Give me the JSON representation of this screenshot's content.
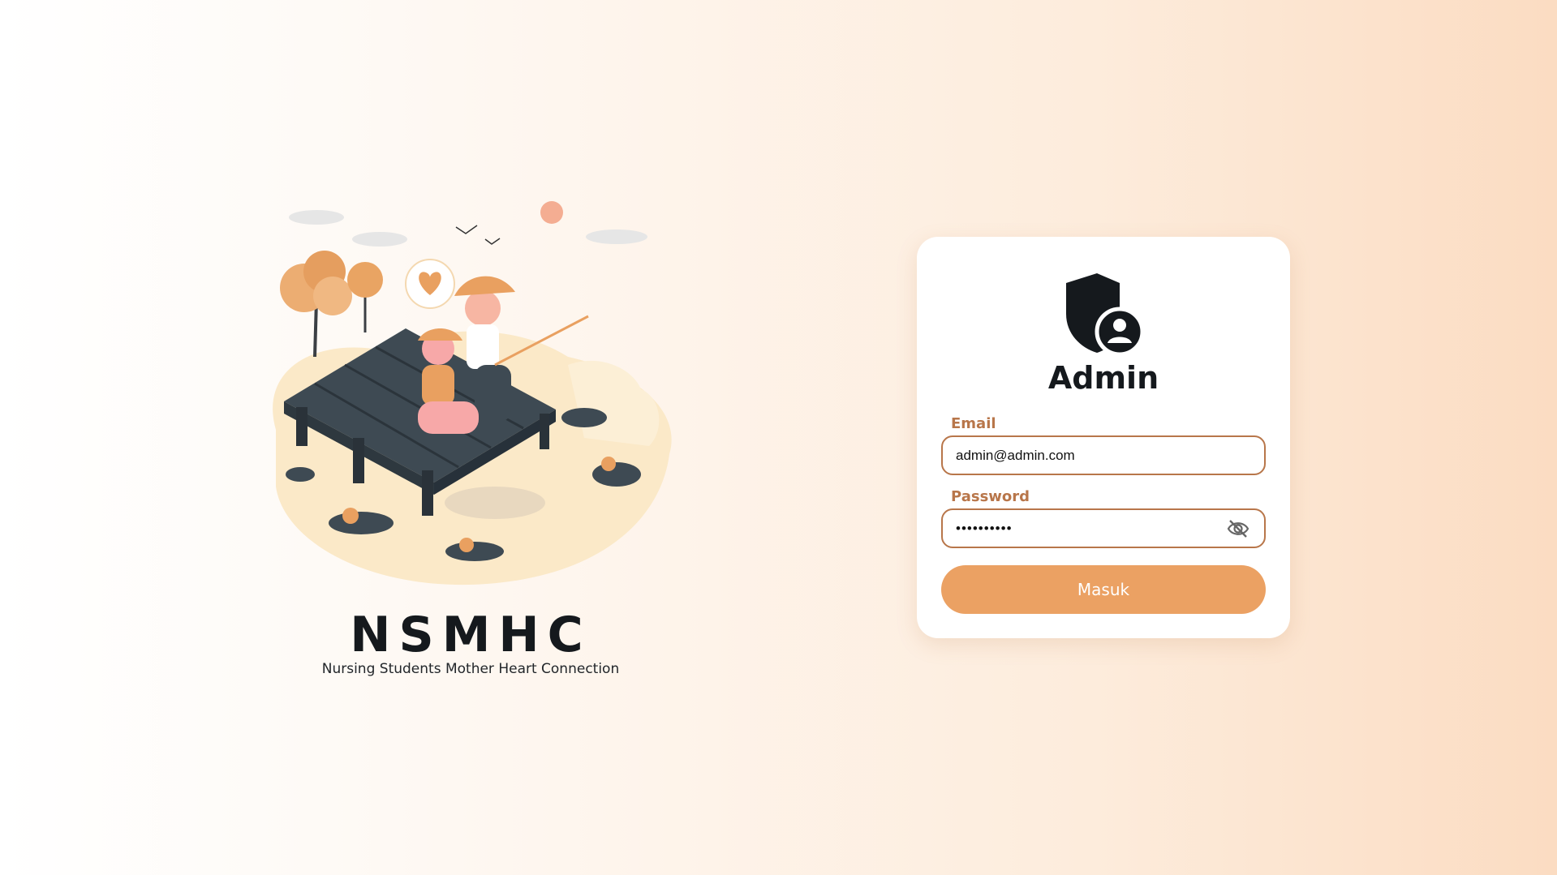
{
  "brand": {
    "title": "NSMHC",
    "subtitle": "Nursing Students Mother Heart Connection"
  },
  "illustration": {
    "description_icon": "fishing-illustration",
    "accent_color": "#e9a060"
  },
  "login": {
    "title": "Admin",
    "icon": "admin-shield-user-icon",
    "email_label": "Email",
    "email_value": "admin@admin.com",
    "password_label": "Password",
    "password_value": "••••••••••",
    "toggle_icon": "eye-off-icon",
    "submit_label": "Masuk"
  },
  "colors": {
    "accent": "#eba163",
    "label": "#b8764a",
    "text_dark": "#15191d"
  }
}
